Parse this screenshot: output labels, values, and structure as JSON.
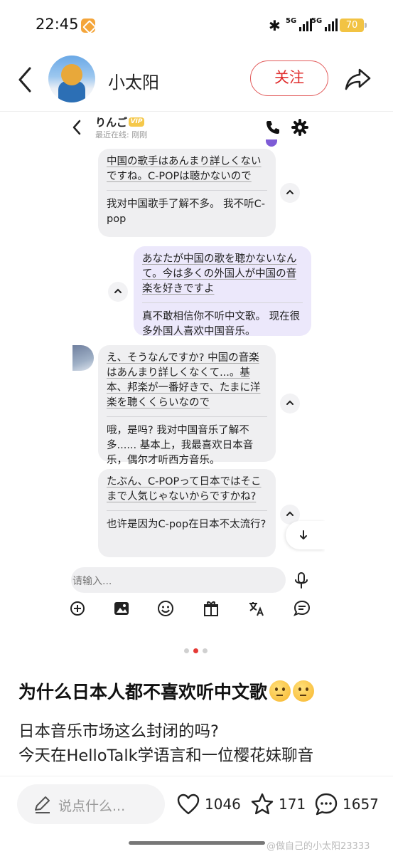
{
  "status_bar": {
    "time": "22:45",
    "network_1": "5G",
    "network_2": "5G",
    "battery": "70"
  },
  "header": {
    "username": "小太阳",
    "follow_label": "关注"
  },
  "chat": {
    "contact_name": "りんご",
    "vip_label": "VIP",
    "last_online": "最近在线: 刚刚",
    "messages": [
      {
        "side": "left",
        "original": "中国の歌手はあんまり詳しくないですね。C-POPは聴かないので",
        "translation": "我对中国歌手了解不多。 我不听C-pop"
      },
      {
        "side": "right",
        "original": "あなたが中国の歌を聴かないなんて。今は多くの外国人が中国の音楽を好きですよ",
        "translation": "真不敢相信你不听中文歌。 现在很多外国人喜欢中国音乐。"
      },
      {
        "side": "left",
        "original": "え、そうなんですか? 中国の音楽はあんまり詳しくなくて...。基本、邦楽が一番好きで、たまに洋楽を聴くくらいなので",
        "translation": "哦，是吗? 我对中国音乐了解不多...... 基本上，我最喜欢日本音乐，偶尔才听西方音乐。"
      },
      {
        "side": "left",
        "original": "たぶん、C-POPって日本ではそこまで人気じゃないからですかね?",
        "translation": "也许是因为C-pop在日本不太流行?"
      }
    ],
    "input_placeholder": "请输入..."
  },
  "carousel": {
    "count": 3,
    "active_index": 1
  },
  "post": {
    "title": "为什么日本人都不喜欢听中文歌",
    "line1": "日本音乐市场这么封闭的吗?",
    "line2": "今天在HelloTalk学语言和一位樱花妹聊音"
  },
  "bottom_bar": {
    "comment_placeholder": "说点什么...",
    "likes": "1046",
    "favorites": "171",
    "comments": "1657"
  },
  "watermark": "@做自己的小太阳23333",
  "colors": {
    "accent_red": "#e02e2e",
    "chat_purple": "#ece8fb",
    "chat_grey": "#efeff1",
    "battery_yellow": "#f2c343"
  },
  "icons": [
    "back-icon",
    "share-icon",
    "phone-icon",
    "gear-icon",
    "mic-icon",
    "add-icon",
    "image-icon",
    "emoji-icon",
    "gift-icon",
    "translate-icon",
    "chat-icon",
    "pencil-icon",
    "heart-icon",
    "star-icon",
    "comment-icon"
  ]
}
